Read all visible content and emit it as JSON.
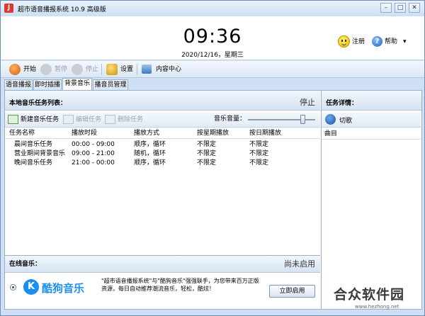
{
  "window": {
    "title": "超市语音播报系统 10.9 高级版",
    "icon_letter": "J"
  },
  "header": {
    "time": "09:36",
    "date": "2020/12/16，星期三",
    "register_label": "注册",
    "help_label": "帮助"
  },
  "toolbar": {
    "start_label": "开始",
    "pause_label": "暂停",
    "stop_label": "停止",
    "settings_label": "设置",
    "content_center_label": "内容中心"
  },
  "tabs": [
    {
      "label": "语音播报"
    },
    {
      "label": "即时插播"
    },
    {
      "label": "背景音乐"
    },
    {
      "label": "播音员管理"
    }
  ],
  "music_panel": {
    "title": "本地音乐任务列表：",
    "status": "停止",
    "new_task_label": "新建音乐任务",
    "edit_task_label": "编辑任务",
    "delete_task_label": "删除任务",
    "volume_label": "音乐音量：",
    "volume_level": 0.82,
    "columns": [
      "任务名称",
      "播放时段",
      "播放方式",
      "按星期播放",
      "按日期播放"
    ],
    "rows": [
      [
        "晨间音乐任务",
        "00:00 - 09:00",
        "顺序，循环",
        "不限定",
        "不限定"
      ],
      [
        "营业期间背景音乐",
        "09:00 - 21:00",
        "随机，循环",
        "不限定",
        "不限定"
      ],
      [
        "晚间音乐任务",
        "21:00 - 00:00",
        "顺序，循环",
        "不限定",
        "不限定"
      ]
    ]
  },
  "online_music": {
    "title": "在线音乐：",
    "status": "尚未启用",
    "logo_letter": "K",
    "brand": "酷狗音乐",
    "promo_text": "\"超市语音播报系统\"与\"酷狗音乐\"强强联手，为您带来百万正版资源，每日自动推荐潮流音乐，轻松，酷炫！",
    "enable_label": "立即启用"
  },
  "task_details": {
    "title": "任务详情：",
    "cut_song_label": "切歌",
    "song_column": "曲目"
  },
  "watermark": {
    "text": "合众软件园",
    "url": "www.hezhong.net"
  }
}
